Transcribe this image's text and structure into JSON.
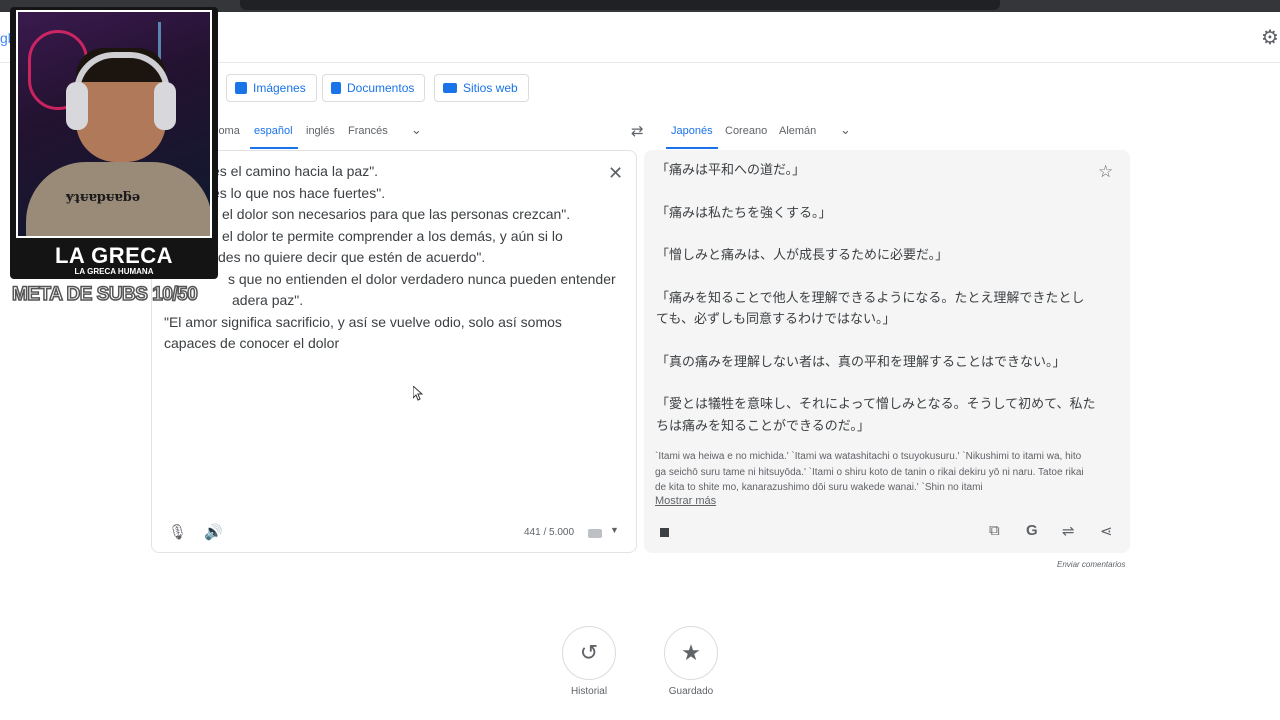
{
  "modes": [
    {
      "label": "Imágenes",
      "icon": "image-icon"
    },
    {
      "label": "Documentos",
      "icon": "document-icon"
    },
    {
      "label": "Sitios web",
      "icon": "website-icon"
    }
  ],
  "source_langs": [
    "ioma",
    "español",
    "inglés",
    "Francés"
  ],
  "target_langs": [
    "Japonés",
    "Coreano",
    "Alemán"
  ],
  "source_lines": [
    "es el camino hacia la paz\".",
    "es lo que nos hace fuertes\".",
    "el dolor son necesarios para que las personas crezcan\".",
    "el dolor te permite comprender a los demás, y aún si lo",
    "des no quiere decir que estén de acuerdo\".",
    "s que no entienden el dolor verdadero nunca pueden entender",
    "adera paz\".",
    "\"El amor significa sacrificio, y así se vuelve odio, solo así somos",
    "capaces de conocer el dolor"
  ],
  "char_count": "441 / 5.000",
  "translation": [
    "「痛みは平和への道だ。」",
    "「痛みは私たちを強くする。」",
    "「憎しみと痛みは、人が成長するために必要だ。」",
    "「痛みを知ることで他人を理解できるようになる。たとえ理解できたとしても、必ずしも同意するわけではない。」",
    "「真の痛みを理解しない者は、真の平和を理解することはできない。」",
    "「愛とは犠牲を意味し、それによって憎しみとなる。そうして初めて、私たちは痛みを知ることができるのだ。」"
  ],
  "romanization": "`Itami wa heiwa e no michida.' `Itami wa watashitachi o tsuyokusuru.' `Nikushimi to itami wa, hito ga seichō suru tame ni hitsuyōda.' `Itami o shiru koto de tanin o rikai dekiru yō ni naru. Tatoe rikai de kita to shite mo, kanarazushimo dōi suru wakede wanai.' `Shin no itami",
  "show_more": "Mostrar más",
  "feedback": "Enviar comentarios",
  "bottom": {
    "history": "Historial",
    "saved": "Guardado"
  },
  "overlay": {
    "brand": "LA GRECA",
    "brand_sub": "LA GRECA HUMANA",
    "shirt": "ɏʇᵾɐpᵾɐƃǝ",
    "meta": "META DE SUBS 10/50"
  },
  "accent": "#1a73e8"
}
